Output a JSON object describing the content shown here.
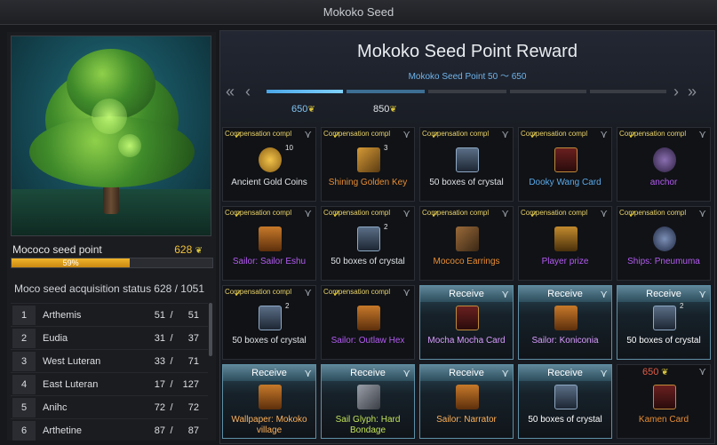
{
  "window": {
    "title": "Mokoko Seed"
  },
  "left": {
    "seed_label": "Mococo seed point",
    "seed_value": "628",
    "progress_percent": 59,
    "progress_label": "59%",
    "acq_label": "Moco seed acquisition status",
    "acq_total": "628 / 1051",
    "regions": [
      {
        "idx": "1",
        "name": "Arthemis",
        "a": "51",
        "b": "51"
      },
      {
        "idx": "2",
        "name": "Eudia",
        "a": "31",
        "b": "37"
      },
      {
        "idx": "3",
        "name": "West Luteran",
        "a": "33",
        "b": "71"
      },
      {
        "idx": "4",
        "name": "East Luteran",
        "a": "17",
        "b": "127"
      },
      {
        "idx": "5",
        "name": "Anihc",
        "a": "72",
        "b": "72"
      },
      {
        "idx": "6",
        "name": "Arthetine",
        "a": "87",
        "b": "87"
      }
    ]
  },
  "reward": {
    "title": "Mokoko Seed Point Reward",
    "subtitle": "Mokoko Seed Point 50 ～ 650",
    "point_650": "650",
    "point_850": "850",
    "compensation_label": "Compensation compl",
    "receive_label": "Receive",
    "locked_price": "650",
    "items": [
      {
        "name": "Ancient Gold Coins",
        "state": "done",
        "color": "white",
        "icon": "coin-icon",
        "qty": "10"
      },
      {
        "name": "Shining Golden Key",
        "state": "done",
        "color": "orange",
        "icon": "key-icon",
        "qty": "3"
      },
      {
        "name": "50 boxes of crystal",
        "state": "done",
        "color": "white",
        "icon": "chest-icon",
        "qty": ""
      },
      {
        "name": "Dooky Wang Card",
        "state": "done",
        "color": "blue",
        "icon": "card-icon",
        "qty": ""
      },
      {
        "name": "anchor",
        "state": "done",
        "color": "purple",
        "icon": "anchor-icon",
        "qty": ""
      },
      {
        "name": "Sailor: Sailor Eshu",
        "state": "done",
        "color": "purple",
        "icon": "scroll-icon",
        "qty": ""
      },
      {
        "name": "50 boxes of crystal",
        "state": "done",
        "color": "white",
        "icon": "chest-icon",
        "qty": "2"
      },
      {
        "name": "Mococo Earrings",
        "state": "done",
        "color": "orange",
        "icon": "earring-icon",
        "qty": ""
      },
      {
        "name": "Player prize",
        "state": "done",
        "color": "purple",
        "icon": "trophy-icon",
        "qty": ""
      },
      {
        "name": "Ships: Pneumuma",
        "state": "done",
        "color": "purple",
        "icon": "ship-icon",
        "qty": ""
      },
      {
        "name": "50 boxes of crystal",
        "state": "done",
        "color": "white",
        "icon": "chest-icon",
        "qty": "2"
      },
      {
        "name": "Sailor: Outlaw Hex",
        "state": "done",
        "color": "purple",
        "icon": "scroll-icon",
        "qty": ""
      },
      {
        "name": "Mocha Mocha Card",
        "state": "receive",
        "color": "purple",
        "icon": "card-icon",
        "qty": ""
      },
      {
        "name": "Sailor: Koniconia",
        "state": "receive",
        "color": "purple",
        "icon": "scroll-icon",
        "qty": ""
      },
      {
        "name": "50 boxes of crystal",
        "state": "receive",
        "color": "white",
        "icon": "chest-icon",
        "qty": "2"
      },
      {
        "name": "Wallpaper: Mokoko village",
        "state": "receive",
        "color": "orange",
        "icon": "scroll-icon",
        "qty": ""
      },
      {
        "name": "Sail Glyph: Hard Bondage",
        "state": "receive",
        "color": "green",
        "icon": "glyph-icon",
        "qty": ""
      },
      {
        "name": "Sailor: Narrator",
        "state": "receive",
        "color": "orange",
        "icon": "scroll-icon",
        "qty": ""
      },
      {
        "name": "50 boxes of crystal",
        "state": "receive",
        "color": "white",
        "icon": "chest-icon",
        "qty": ""
      },
      {
        "name": "Kamen Card",
        "state": "locked",
        "color": "orange",
        "icon": "card-icon",
        "qty": ""
      }
    ]
  },
  "colors": {
    "accent": "#f1c23c",
    "blue": "#5aa9e8",
    "orange": "#e88d34",
    "purple": "#b35cf0",
    "green": "#c4e35a"
  }
}
